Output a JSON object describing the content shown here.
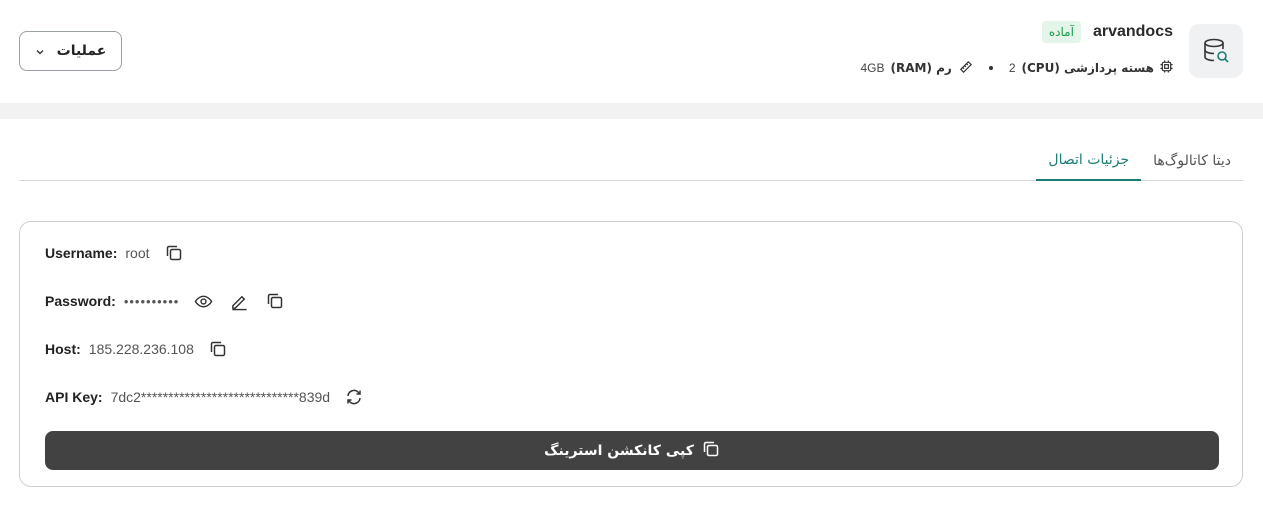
{
  "service": {
    "name": "arvandocs",
    "status": "آماده",
    "icon": "database-search-icon"
  },
  "specs": {
    "cpu_label": "هسته پردازشی (CPU)",
    "cpu_value": "2",
    "ram_label": "رم (RAM)",
    "ram_value": "4GB"
  },
  "actions": {
    "label": "عملیات"
  },
  "tabs": [
    {
      "label": "دیتا کاتالوگ‌ها",
      "active": false
    },
    {
      "label": "جزئیات اتصال",
      "active": true
    }
  ],
  "connection": {
    "username_label": "Username:",
    "username_value": "root",
    "password_label": "Password:",
    "password_value": "••••••••••",
    "host_label": "Host:",
    "host_value": "185.228.236.108",
    "apikey_label": "API Key:",
    "apikey_value": "7dc2*****************************839d",
    "copy_connection_label": "کپی کانکشن استرینگ"
  },
  "colors": {
    "accent": "#1a7d74",
    "status_bg": "#e4f6ea",
    "status_fg": "#1a9a4b",
    "primary_button": "#424242"
  }
}
